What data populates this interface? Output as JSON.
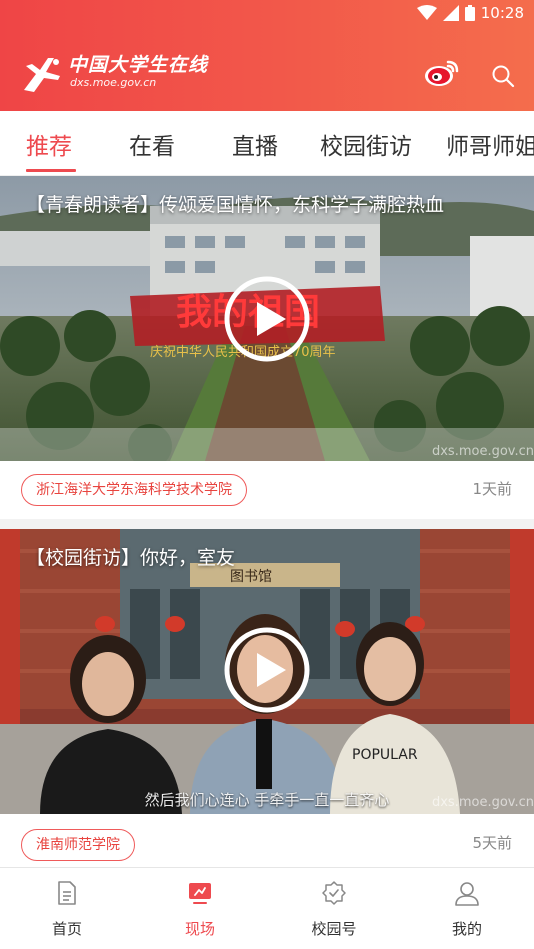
{
  "status_bar": {
    "time": "10:28"
  },
  "header": {
    "logo_title": "中国大学生在线",
    "logo_url": "dxs.moe.gov.cn",
    "weibo_icon": "weibo-icon",
    "search_icon": "search-icon"
  },
  "tabs": [
    {
      "label": "推荐",
      "active": true
    },
    {
      "label": "在看"
    },
    {
      "label": "直播"
    },
    {
      "label": "校园街访"
    },
    {
      "label": "师哥师姐"
    }
  ],
  "feed": [
    {
      "title": "【青春朗读者】传颂爱国情怀，东科学子满腔热血",
      "tag": "浙江海洋大学东海科学技术学院",
      "time": "1天前",
      "watermark": "dxs.moe.gov.cn",
      "banner_text": "我的祖国",
      "banner_sub": "庆祝中华人民共和国成立70周年"
    },
    {
      "title": "【校园街访】你好，室友",
      "tag": "淮南师范学院",
      "time": "5天前",
      "watermark": "dxs.moe.gov.cn",
      "subtitle": "然后我们心连心 手牵手一直一直齐心",
      "library_sign": "图书馆",
      "shirt_text": "POPULAR"
    }
  ],
  "bottom_nav": [
    {
      "label": "首页",
      "icon": "document-icon"
    },
    {
      "label": "现场",
      "icon": "live-screen-icon",
      "active": true
    },
    {
      "label": "校园号",
      "icon": "badge-check-icon"
    },
    {
      "label": "我的",
      "icon": "user-icon"
    }
  ],
  "colors": {
    "accent": "#ee4a4f",
    "header_start": "#ef4546",
    "header_end": "#f46d4c"
  }
}
